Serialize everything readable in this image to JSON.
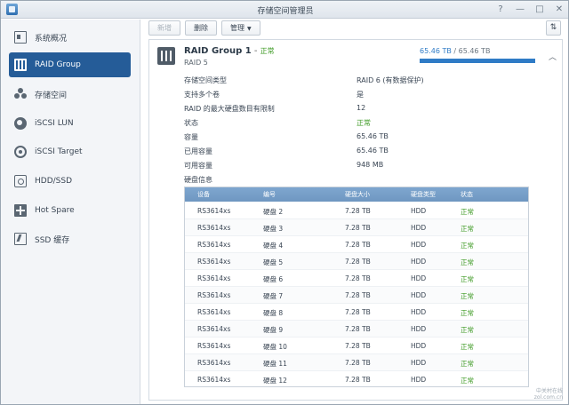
{
  "window": {
    "title": "存储空间管理员",
    "controls": [
      "?",
      "—",
      "□",
      "✕"
    ]
  },
  "sidebar": {
    "items": [
      {
        "label": "系统概况",
        "icon": "overview-icon"
      },
      {
        "label": "RAID Group",
        "icon": "raid-group-icon",
        "active": true
      },
      {
        "label": "存储空间",
        "icon": "volume-icon"
      },
      {
        "label": "iSCSI LUN",
        "icon": "iscsi-lun-icon"
      },
      {
        "label": "iSCSI Target",
        "icon": "iscsi-target-icon"
      },
      {
        "label": "HDD/SSD",
        "icon": "hdd-icon"
      },
      {
        "label": "Hot Spare",
        "icon": "hot-spare-icon"
      },
      {
        "label": "SSD 缓存",
        "icon": "ssd-cache-icon"
      }
    ]
  },
  "toolbar": {
    "create_label": "新增",
    "delete_label": "删除",
    "manage_label": "管理",
    "manage_caret": "▼",
    "sort_icon": "sort-icon"
  },
  "raid": {
    "name": "RAID Group 1",
    "separator": " - ",
    "status": "正常",
    "level": "RAID 5",
    "capacity_used": "65.46 TB",
    "capacity_sep": " / ",
    "capacity_total": "65.46 TB",
    "capacity_fraction": 1.0,
    "collapse_icon": "chevron-up-icon"
  },
  "properties": [
    {
      "key": "存储空间类型",
      "value": "RAID 6 (有数据保护)"
    },
    {
      "key": "支持多个卷",
      "value": "是"
    },
    {
      "key": "RAID 的最大硬盘数目有限制",
      "value": "12"
    },
    {
      "key": "状态",
      "value": "正常",
      "ok": true
    },
    {
      "key": "容量",
      "value": "65.46 TB"
    },
    {
      "key": "已用容量",
      "value": "65.46 TB"
    },
    {
      "key": "可用容量",
      "value": "948 MB"
    }
  ],
  "disks": {
    "section_title": "硬盘信息",
    "headers": [
      "设备",
      "编号",
      "硬盘大小",
      "硬盘类型",
      "状态"
    ],
    "rows": [
      {
        "device": "RS3614xs",
        "number": "硬盘 2",
        "size": "7.28 TB",
        "type": "HDD",
        "status": "正常"
      },
      {
        "device": "RS3614xs",
        "number": "硬盘 3",
        "size": "7.28 TB",
        "type": "HDD",
        "status": "正常"
      },
      {
        "device": "RS3614xs",
        "number": "硬盘 4",
        "size": "7.28 TB",
        "type": "HDD",
        "status": "正常"
      },
      {
        "device": "RS3614xs",
        "number": "硬盘 5",
        "size": "7.28 TB",
        "type": "HDD",
        "status": "正常"
      },
      {
        "device": "RS3614xs",
        "number": "硬盘 6",
        "size": "7.28 TB",
        "type": "HDD",
        "status": "正常"
      },
      {
        "device": "RS3614xs",
        "number": "硬盘 7",
        "size": "7.28 TB",
        "type": "HDD",
        "status": "正常"
      },
      {
        "device": "RS3614xs",
        "number": "硬盘 8",
        "size": "7.28 TB",
        "type": "HDD",
        "status": "正常"
      },
      {
        "device": "RS3614xs",
        "number": "硬盘 9",
        "size": "7.28 TB",
        "type": "HDD",
        "status": "正常"
      },
      {
        "device": "RS3614xs",
        "number": "硬盘 10",
        "size": "7.28 TB",
        "type": "HDD",
        "status": "正常"
      },
      {
        "device": "RS3614xs",
        "number": "硬盘 11",
        "size": "7.28 TB",
        "type": "HDD",
        "status": "正常"
      },
      {
        "device": "RS3614xs",
        "number": "硬盘 12",
        "size": "7.28 TB",
        "type": "HDD",
        "status": "正常"
      }
    ]
  },
  "watermark": {
    "line1": "中关村在线",
    "line2": "zol.com.cn"
  },
  "colors": {
    "accent": "#255c98",
    "ok": "#3d9a23",
    "capacity": "#2f7bc6",
    "table_header": "#7ea6cf"
  }
}
